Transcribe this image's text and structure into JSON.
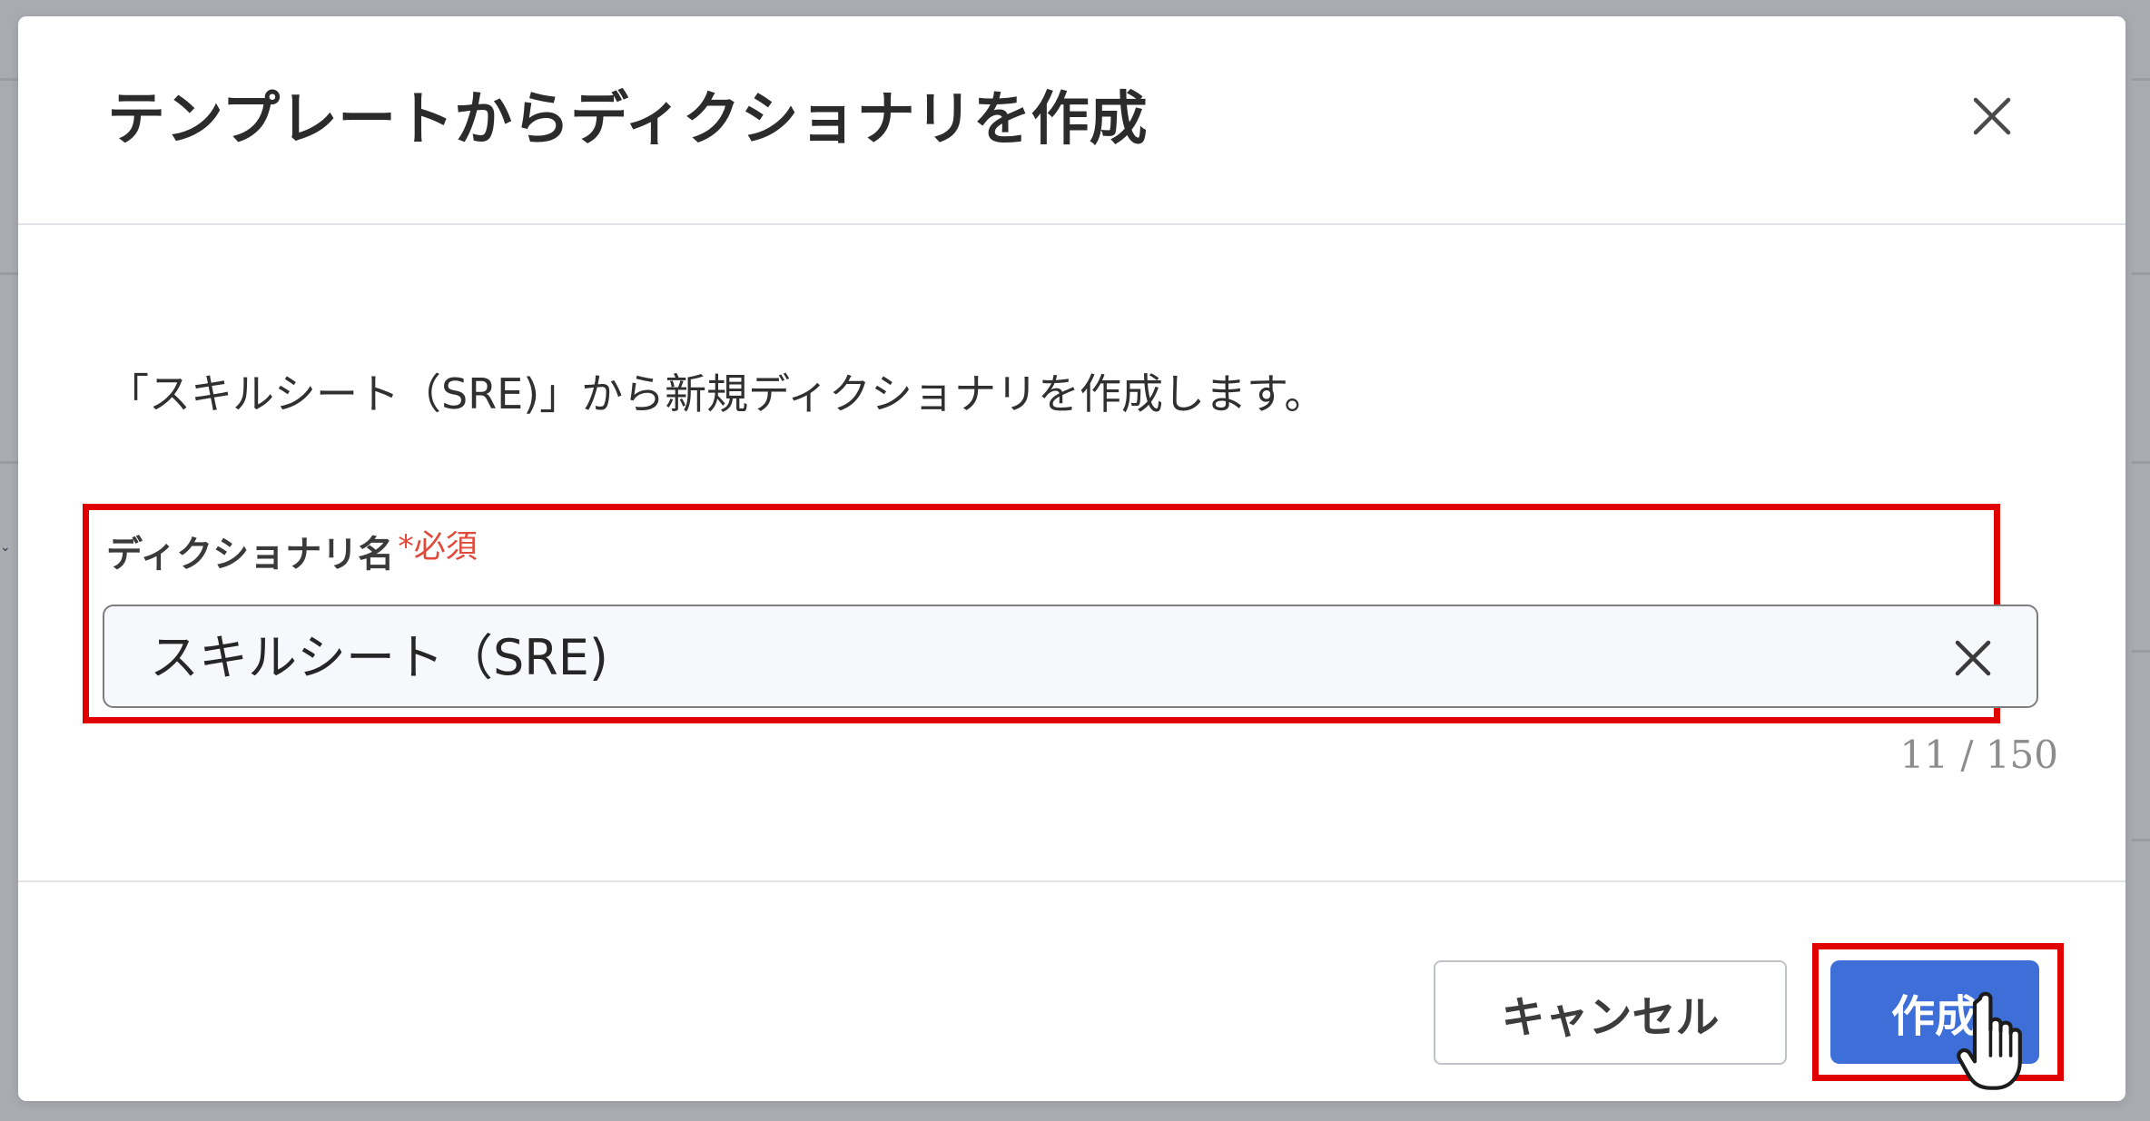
{
  "dialog": {
    "title": "テンプレートからディクショナリを作成",
    "close_icon": "close-icon",
    "description": "「スキルシート（SRE)」から新規ディクショナリを作成します。",
    "field": {
      "label": "ディクショナリ名",
      "required_mark": "*必須",
      "value": "スキルシート（SRE)",
      "clear_icon": "clear-icon",
      "counter": "11 / 150"
    },
    "footer": {
      "cancel_label": "キャンセル",
      "create_label": "作成"
    }
  },
  "highlight_color": "#e00000",
  "primary_color": "#3e6fd8",
  "cursor_icon": "hand-pointer-icon"
}
